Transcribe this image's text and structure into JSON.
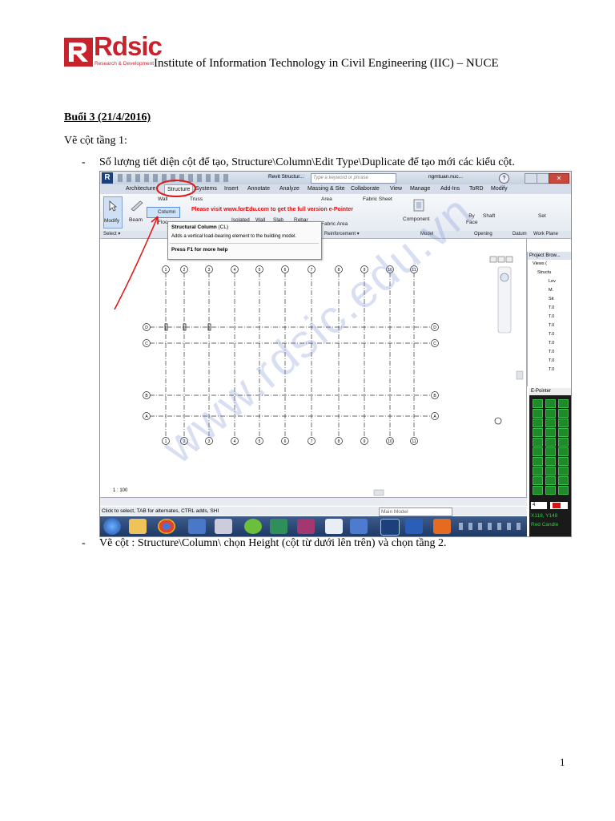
{
  "header": {
    "logo_text": "Rdsic",
    "logo_tagline": "Research & Development",
    "institute": "Institute of Information Technology in Civil Engineering (IIC) – NUCE"
  },
  "session_title": "Buổi 3 (21/4/2016)",
  "subtitle": "Vẽ cột tầng 1:",
  "bullets": [
    {
      "marker": "-",
      "text": "Số lượng tiết diện cột để tạo, Structure\\Column\\Edit Type\\Duplicate để tạo mới các kiểu cột."
    },
    {
      "marker": "-",
      "text": "Vẽ cột : Structure\\Column\\ chọn Height (cột từ dưới lên trên) và chọn tầng 2."
    }
  ],
  "page_number": "1",
  "watermark": "www.rdsic.edu.vn",
  "revit": {
    "title_search_placeholder": "Type a keyword or phrase",
    "title_app": "Revit Structur...",
    "user": "ngmtuan.nuc...",
    "tabs": [
      "Architecture",
      "Structure",
      "Systems",
      "Insert",
      "Annotate",
      "Analyze",
      "Massing & Site",
      "Collaborate",
      "View",
      "Manage",
      "Add-Ins",
      "ToRD",
      "Modify"
    ],
    "ribbon_buttons": {
      "modify": "Modify",
      "beam": "Beam",
      "wall": "Wall",
      "column": "Column",
      "floor": "Floo",
      "truss": "Truss",
      "isolated": "Isolated",
      "wall2": "Wall",
      "slab": "Slab",
      "rebar": "Rebar",
      "area": "Area",
      "fabric_sheet": "Fabric Sheet",
      "fabric_area": "Fabric Area",
      "component": "Component",
      "by_face": "By Face",
      "shaft": "Shaft",
      "set": "Set"
    },
    "panels": [
      "Select ▾",
      "Reinforcement ▾",
      "Model",
      "Opening",
      "Datum",
      "Work Plane"
    ],
    "red_note": "Please visit www.forEdu.com to get the full version e-Pointer",
    "tooltip": {
      "title": "Structural Column",
      "shortcut": "(CL)",
      "description": "Adds a vertical load-bearing element to the building model.",
      "help": "Press F1 for more help"
    },
    "grid_numbers": [
      "1",
      "2",
      "3",
      "4",
      "5",
      "6",
      "7",
      "8",
      "9",
      "10",
      "11"
    ],
    "grid_letters": [
      "D",
      "C",
      "B",
      "A"
    ],
    "scale": "1 : 100",
    "status": "Click to select, TAB for alternates, CTRL adds, SHI",
    "model_select": "Main Model",
    "project_browser": {
      "title": "Project Brow...",
      "items": [
        "Views (",
        "Structu",
        "Lev",
        "M.",
        "Sit",
        "T.0",
        "T.0",
        "T.0",
        "T.0",
        "T.0",
        "T.0",
        "T.0",
        "T.0"
      ]
    },
    "epointer": {
      "title": "E-Pointer",
      "size": "4",
      "coords": "X118, Y148",
      "mode": "Red Candle"
    }
  }
}
